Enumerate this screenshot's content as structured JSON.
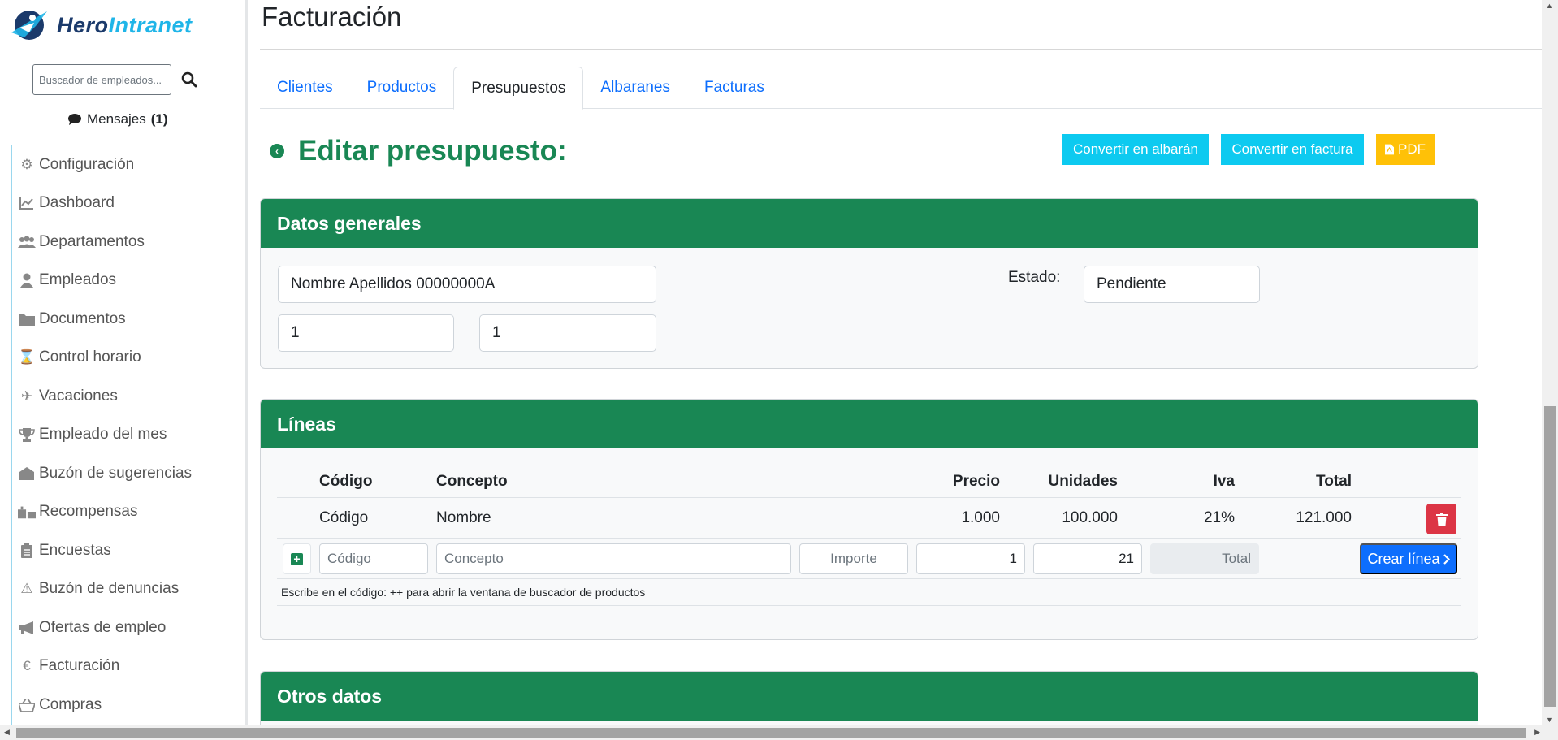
{
  "app": {
    "logo_part1": "Hero",
    "logo_part2": "Intranet"
  },
  "sidebar": {
    "search_placeholder": "Buscador de empleados...",
    "messages_label": "Mensajes",
    "messages_count": "(1)",
    "items": [
      {
        "label": "Configuración",
        "icon": "gear-icon"
      },
      {
        "label": "Dashboard",
        "icon": "chart-line-icon"
      },
      {
        "label": "Departamentos",
        "icon": "users-icon"
      },
      {
        "label": "Empleados",
        "icon": "user-icon"
      },
      {
        "label": "Documentos",
        "icon": "folder-icon"
      },
      {
        "label": "Control horario",
        "icon": "hourglass-icon"
      },
      {
        "label": "Vacaciones",
        "icon": "plane-icon"
      },
      {
        "label": "Empleado del mes",
        "icon": "trophy-icon"
      },
      {
        "label": "Buzón de sugerencias",
        "icon": "envelope-open-icon"
      },
      {
        "label": "Recompensas",
        "icon": "gift-icon"
      },
      {
        "label": "Encuestas",
        "icon": "clipboard-list-icon"
      },
      {
        "label": "Buzón de denuncias",
        "icon": "warning-icon"
      },
      {
        "label": "Ofertas de empleo",
        "icon": "megaphone-icon"
      },
      {
        "label": "Facturación",
        "icon": "euro-icon"
      },
      {
        "label": "Compras",
        "icon": "basket-icon"
      }
    ]
  },
  "page": {
    "title": "Facturación",
    "tabs": [
      {
        "label": "Clientes",
        "active": false
      },
      {
        "label": "Productos",
        "active": false
      },
      {
        "label": "Presupuestos",
        "active": true
      },
      {
        "label": "Albaranes",
        "active": false
      },
      {
        "label": "Facturas",
        "active": false
      }
    ],
    "edit_title": "Editar presupuesto:",
    "buttons": {
      "convert_albaran": "Convertir en albarán",
      "convert_factura": "Convertir en factura",
      "pdf": "PDF"
    }
  },
  "general": {
    "title": "Datos generales",
    "client": "Nombre Apellidos 00000000A",
    "field_a": "1",
    "field_b": "1",
    "estado_label": "Estado:",
    "estado_value": "Pendiente"
  },
  "lines": {
    "title": "Líneas",
    "columns": {
      "codigo": "Código",
      "concepto": "Concepto",
      "precio": "Precio",
      "unidades": "Unidades",
      "iva": "Iva",
      "total": "Total"
    },
    "rows": [
      {
        "codigo": "Código",
        "concepto": "Nombre",
        "precio": "1.000",
        "unidades": "100.000",
        "iva": "21%",
        "total": "121.000"
      }
    ],
    "form": {
      "codigo_placeholder": "Código",
      "concepto_placeholder": "Concepto",
      "importe_placeholder": "Importe",
      "unidades_value": "1",
      "iva_value": "21",
      "total_placeholder": "Total",
      "create_label": "Crear línea"
    },
    "hint": "Escribe en el código: ++ para abrir la ventana de buscador de productos"
  },
  "other": {
    "title": "Otros datos"
  },
  "colors": {
    "primary_green": "#198754",
    "cyan": "#0dcaf0",
    "yellow": "#ffc107",
    "blue": "#0d6efd",
    "red": "#dc3545"
  }
}
